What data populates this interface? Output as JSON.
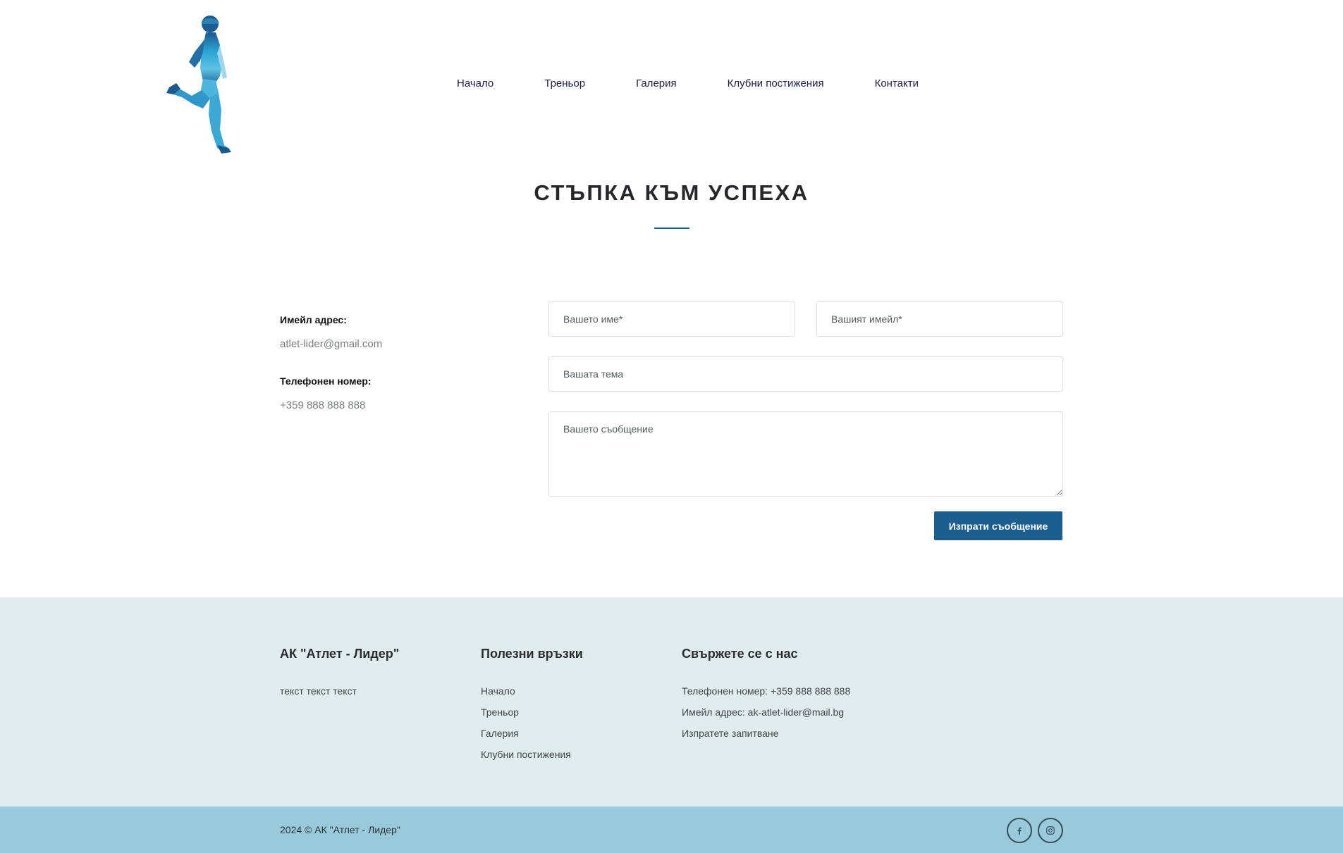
{
  "nav": {
    "items": [
      {
        "label": "Начало"
      },
      {
        "label": "Треньор"
      },
      {
        "label": "Галерия"
      },
      {
        "label": "Клубни постижения"
      },
      {
        "label": "Контакти"
      }
    ]
  },
  "hero": {
    "title": "СТЪПКА КЪМ УСПЕХА"
  },
  "contact_info": {
    "email_label": "Имейл адрес:",
    "email_value": "atlet-lider@gmail.com",
    "phone_label": "Телефонен номер:",
    "phone_value": "+359 888 888 888"
  },
  "form": {
    "name_placeholder": "Вашето име*",
    "email_placeholder": "Вашият имейл*",
    "subject_placeholder": "Вашата тема",
    "message_placeholder": "Вашето съобщение",
    "submit_label": "Изпрати съобщение"
  },
  "footer": {
    "about": {
      "heading": "АК \"Атлет - Лидер\"",
      "text": "текст текст текст"
    },
    "links": {
      "heading": "Полезни връзки",
      "items": [
        {
          "label": "Начало"
        },
        {
          "label": "Треньор"
        },
        {
          "label": "Галерия"
        },
        {
          "label": "Клубни постижения"
        }
      ]
    },
    "contact": {
      "heading": "Свържете се с нас",
      "phone": "Телефонен номер: +359 888 888 888",
      "email": "Имейл адрес: ak-atlet-lider@mail.bg",
      "inquiry": "Изпратете запитване"
    },
    "copyright": "2024 © АК \"Атлет - Лидер\"",
    "social": [
      {
        "icon": "facebook-icon"
      },
      {
        "icon": "instagram-icon"
      }
    ]
  },
  "colors": {
    "accent": "#1c5f8e",
    "footer_bg": "#e1ecee",
    "footer_bottom_bg": "#98cadc",
    "nav_text": "#1c1e47"
  }
}
